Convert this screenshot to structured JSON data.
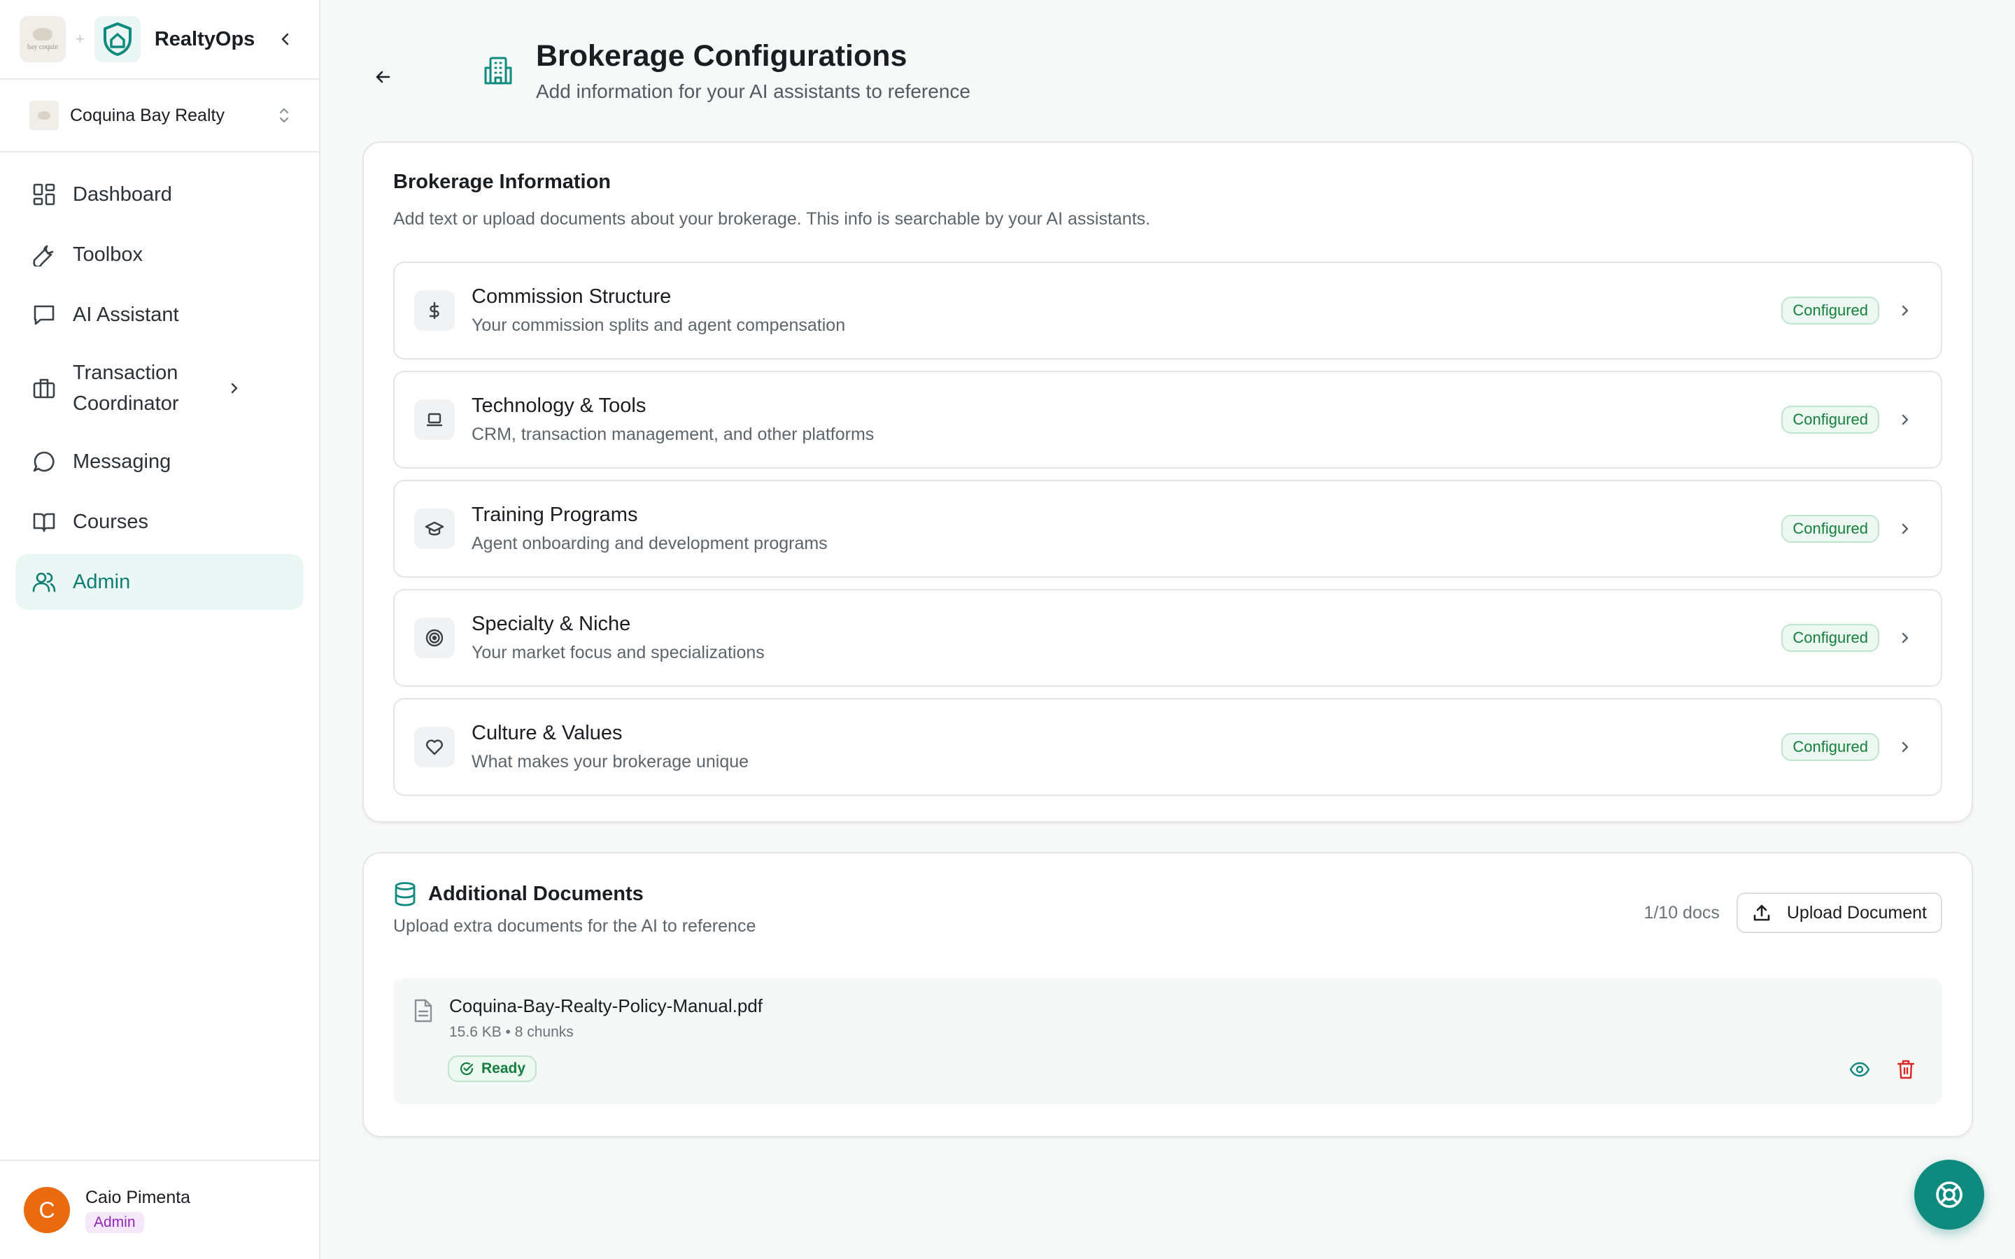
{
  "brand": {
    "name": "RealtyOps",
    "client_logo_text": "bay coquin"
  },
  "org": {
    "name": "Coquina Bay Realty"
  },
  "nav": {
    "dashboard": "Dashboard",
    "toolbox": "Toolbox",
    "ai_assistant": "AI Assistant",
    "transaction_coordinator": "Transaction Coordinator",
    "messaging": "Messaging",
    "courses": "Courses",
    "admin": "Admin"
  },
  "user": {
    "initial": "C",
    "name": "Caio Pimenta",
    "role": "Admin"
  },
  "header": {
    "title": "Brokerage Configurations",
    "subtitle": "Add information for your AI assistants to reference"
  },
  "brokerage_info": {
    "title": "Brokerage Information",
    "description": "Add text or upload documents about your brokerage. This info is searchable by your AI assistants.",
    "sections": [
      {
        "title": "Commission Structure",
        "subtitle": "Your commission splits and agent compensation",
        "status": "Configured",
        "icon": "dollar-icon"
      },
      {
        "title": "Technology & Tools",
        "subtitle": "CRM, transaction management, and other platforms",
        "status": "Configured",
        "icon": "laptop-icon"
      },
      {
        "title": "Training Programs",
        "subtitle": "Agent onboarding and development programs",
        "status": "Configured",
        "icon": "graduation-cap-icon"
      },
      {
        "title": "Specialty & Niche",
        "subtitle": "Your market focus and specializations",
        "status": "Configured",
        "icon": "target-icon"
      },
      {
        "title": "Culture & Values",
        "subtitle": "What makes your brokerage unique",
        "status": "Configured",
        "icon": "heart-icon"
      }
    ]
  },
  "additional_docs": {
    "title": "Additional Documents",
    "description": "Upload extra documents for the AI to reference",
    "count": "1/10 docs",
    "upload_label": "Upload Document",
    "documents": [
      {
        "name": "Coquina-Bay-Realty-Policy-Manual.pdf",
        "meta": "15.6 KB • 8 chunks",
        "status": "Ready"
      }
    ]
  },
  "colors": {
    "accent": "#0e8a7e",
    "active_bg": "#eaf7f5",
    "success": "#15803d",
    "danger": "#dc2626",
    "avatar": "#ea6a10",
    "role_badge": "#9126b8"
  }
}
